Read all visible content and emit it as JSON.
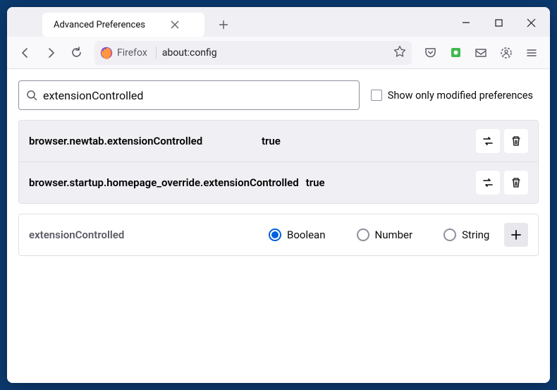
{
  "tab": {
    "title": "Advanced Preferences"
  },
  "urlbar": {
    "identity": "Firefox",
    "url": "about:config"
  },
  "content": {
    "search": {
      "value": "extensionControlled"
    },
    "checkbox_label": "Show only modified preferences",
    "rows": [
      {
        "name": "browser.newtab.extensionControlled",
        "value": "true"
      },
      {
        "name": "browser.startup.homepage_override.extensionControlled",
        "value": "true"
      }
    ],
    "addrow": {
      "name": "extensionControlled",
      "options": [
        "Boolean",
        "Number",
        "String"
      ]
    }
  }
}
